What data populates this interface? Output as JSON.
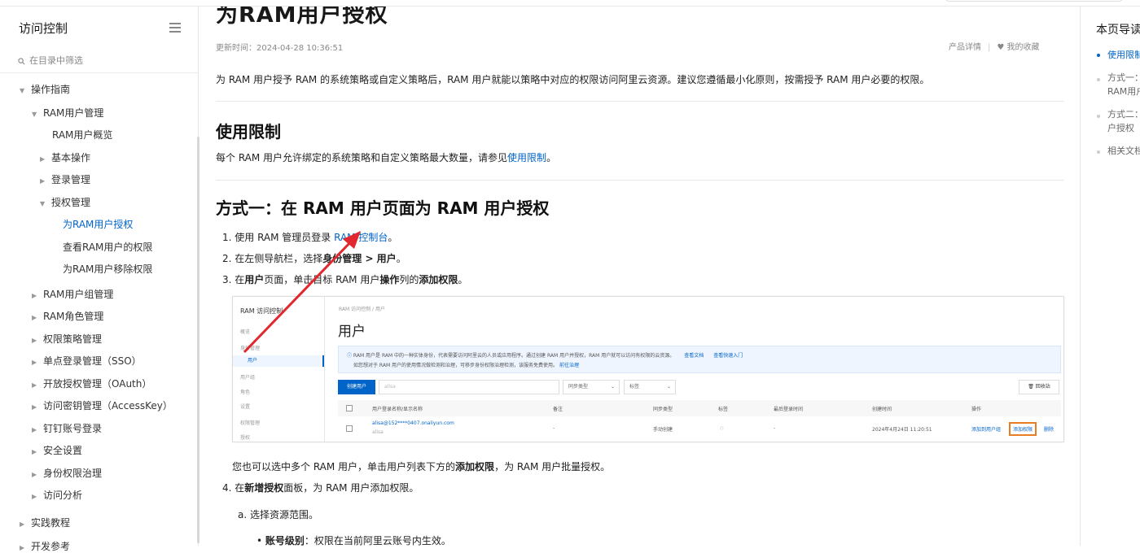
{
  "sidebar": {
    "title": "访问控制",
    "search_placeholder": "在目录中筛选",
    "items": [
      {
        "label": "操作指南"
      },
      {
        "label": "RAM用户管理"
      },
      {
        "label": "RAM用户概览"
      },
      {
        "label": "基本操作"
      },
      {
        "label": "登录管理"
      },
      {
        "label": "授权管理"
      },
      {
        "label": "为RAM用户授权"
      },
      {
        "label": "查看RAM用户的权限"
      },
      {
        "label": "为RAM用户移除权限"
      },
      {
        "label": "RAM用户组管理"
      },
      {
        "label": "RAM角色管理"
      },
      {
        "label": "权限策略管理"
      },
      {
        "label": "单点登录管理（SSO）"
      },
      {
        "label": "开放授权管理（OAuth）"
      },
      {
        "label": "访问密钥管理（AccessKey）"
      },
      {
        "label": "钉钉账号登录"
      },
      {
        "label": "安全设置"
      },
      {
        "label": "身份权限治理"
      },
      {
        "label": "访问分析"
      },
      {
        "label": "实践教程"
      },
      {
        "label": "开发参考"
      }
    ]
  },
  "article": {
    "title": "为RAM用户授权",
    "updated": "更新时间：2024-04-28 10:36:51",
    "product_detail": "产品详情",
    "favorite": "我的收藏",
    "intro": "为 RAM 用户授予 RAM 的系统策略或自定义策略后，RAM 用户就能以策略中对应的权限访问阿里云资源。建议您遵循最小化原则，按需授予 RAM 用户必要的权限。",
    "section1_title": "使用限制",
    "section1_text": "每个 RAM 用户允许绑定的系统策略和自定义策略最大数量，请参见",
    "section1_link": "使用限制",
    "section1_end": "。",
    "section2_title": "方式一：在 RAM 用户页面为 RAM 用户授权",
    "step1_pre": "1. 使用 RAM 管理员登录 ",
    "step1_link": "RAM 控制台",
    "step1_end": "。",
    "step2_pre": "2. 在左侧导航栏，选择",
    "step2_bold": "身份管理 > 用户",
    "step2_end": "。",
    "step3_pre": "3. 在",
    "step3_b1": "用户",
    "step3_mid1": "页面，单击目标 RAM 用户",
    "step3_b2": "操作",
    "step3_mid2": "列的",
    "step3_b3": "添加权限",
    "step3_end": "。",
    "batch_pre": "您也可以选中多个 RAM 用户，单击用户列表下方的",
    "batch_bold": "添加权限",
    "batch_end": "，为 RAM 用户批量授权。",
    "step4_pre": "4. 在",
    "step4_bold": "新增授权",
    "step4_end": "面板，为 RAM 用户添加权限。",
    "step4a": "a. 选择资源范围。",
    "bullet_bold": "账号级别",
    "bullet_text": "：权限在当前阿里云账号内生效。"
  },
  "screenshot": {
    "console_title": "RAM 访问控制",
    "nav": [
      "概览",
      "身份管理",
      "用户",
      "用户组",
      "角色",
      "设置",
      "权限管理",
      "授权"
    ],
    "crumb": "RAM 访问控制  /  用户",
    "page_title": "用户",
    "notice_line1": "RAM 用户是 RAM 中的一种实体身份，代表需要访问阿里云的人员或应用程序。通过创建 RAM 用户并授权，RAM 用户就可以访问有权限的云资源。",
    "notice_link1": "查看文档",
    "notice_link2": "查看快速入门",
    "notice_line2": "如您想对于 RAM 用户的使用情况做检测和治理，可移步身份权限治理检测，该服务免费使用。",
    "notice_link3": "前往治理",
    "create_btn": "创建用户",
    "search_value": "alisa",
    "sync_type": "同步类型",
    "tag": "标签",
    "recycle": "回收站",
    "columns": [
      "用户登录名称/显示名称",
      "备注",
      "同步类型",
      "标签",
      "最后登录时间",
      "创建时间",
      "操作"
    ],
    "row": {
      "login": "alisa@152****0407.onaliyun.com",
      "display": "alisa",
      "note": "-",
      "sync": "手动创建",
      "last_login": "-",
      "created": "2024年4月24日 11:20:51",
      "op1": "添加到用户组",
      "op2": "添加权限",
      "op3": "删除"
    }
  },
  "toc": {
    "title": "本页导读",
    "items": [
      "使用限制",
      "方式一：在",
      "RAM用户",
      "方式二：",
      "户授权",
      "相关文档"
    ]
  },
  "colors": {
    "accent": "#0064c8",
    "highlight": "#e87d22",
    "arrow": "#e0282e"
  }
}
